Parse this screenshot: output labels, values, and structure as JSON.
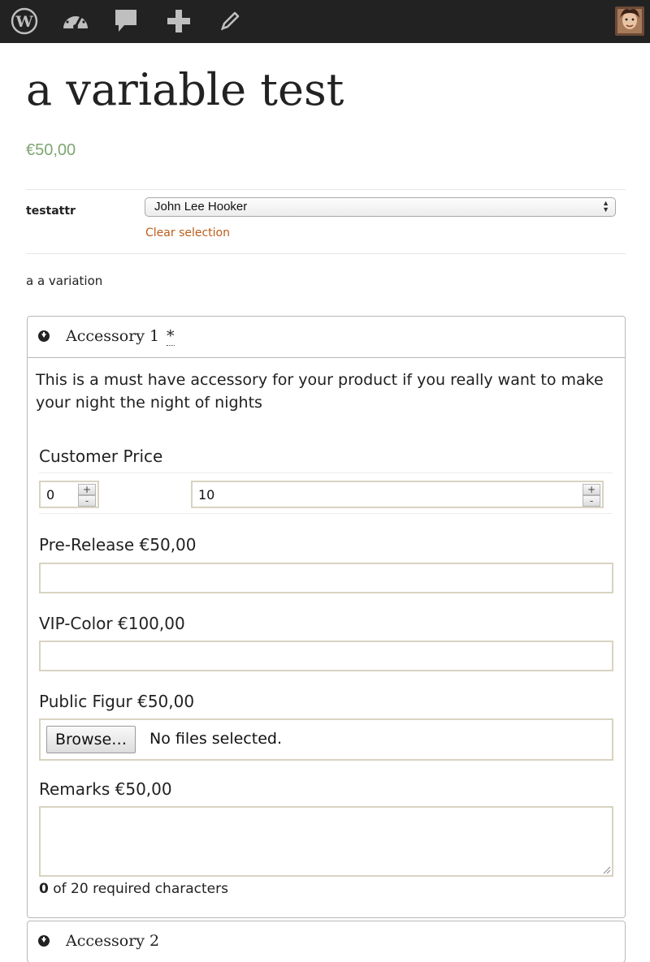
{
  "admin_bar": {
    "icons": [
      "wordpress-icon",
      "dashboard-icon",
      "comments-icon",
      "add-new-icon",
      "edit-icon"
    ],
    "avatar": "user-avatar"
  },
  "product": {
    "title": "a variable test",
    "price": "€50,00"
  },
  "variation": {
    "attribute_label": "testattr",
    "selected_option": "John Lee Hooker",
    "clear_label": "Clear selection",
    "description": "a a variation"
  },
  "accessory1": {
    "name": "Accessory 1",
    "required_mark": "*",
    "description": "This is a must have accessory for your product if you really want to make your night the night of nights",
    "customer_price": {
      "label": "Customer Price",
      "min_value": "0",
      "max_value": "10",
      "plus": "+",
      "minus": "-"
    },
    "pre_release": {
      "label": "Pre-Release €50,00",
      "value": ""
    },
    "vip_color": {
      "label": "VIP-Color €100,00",
      "value": ""
    },
    "public_figur": {
      "label": "Public Figur €50,00",
      "browse": "Browse…",
      "status": "No files selected."
    },
    "remarks": {
      "label": "Remarks €50,00",
      "value": "",
      "count": "0",
      "count_suffix": " of 20 required characters"
    }
  },
  "accessory2": {
    "name": "Accessory 2"
  },
  "colors": {
    "admin_bar": "#222222",
    "price": "#7fa672",
    "link": "#bd5b18",
    "field_border": "#d8d3c1"
  }
}
